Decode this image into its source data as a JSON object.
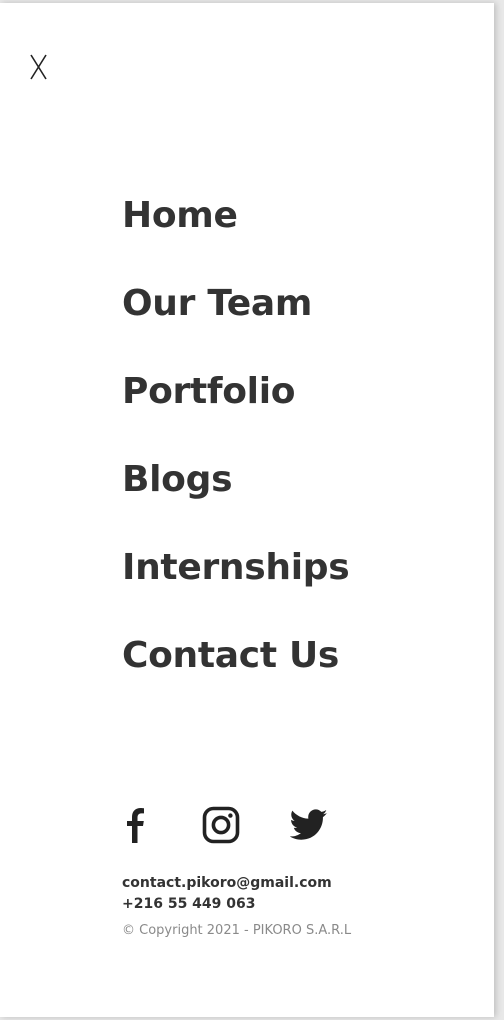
{
  "menu": {
    "close_label": "X",
    "items": [
      {
        "label": "Home"
      },
      {
        "label": "Our Team"
      },
      {
        "label": "Portfolio"
      },
      {
        "label": "Blogs"
      },
      {
        "label": "Internships"
      },
      {
        "label": "Contact Us"
      }
    ]
  },
  "social": {
    "icons": [
      "facebook-icon",
      "instagram-icon",
      "twitter-icon"
    ]
  },
  "contact": {
    "email": "contact.pikoro@gmail.com",
    "phone": "+216 55 449 063",
    "copyright": "© Copyright 2021 - PIKORO S.A.R.L"
  },
  "colors": {
    "text": "#333333",
    "muted": "#8a8a8a",
    "background": "#ffffff"
  }
}
